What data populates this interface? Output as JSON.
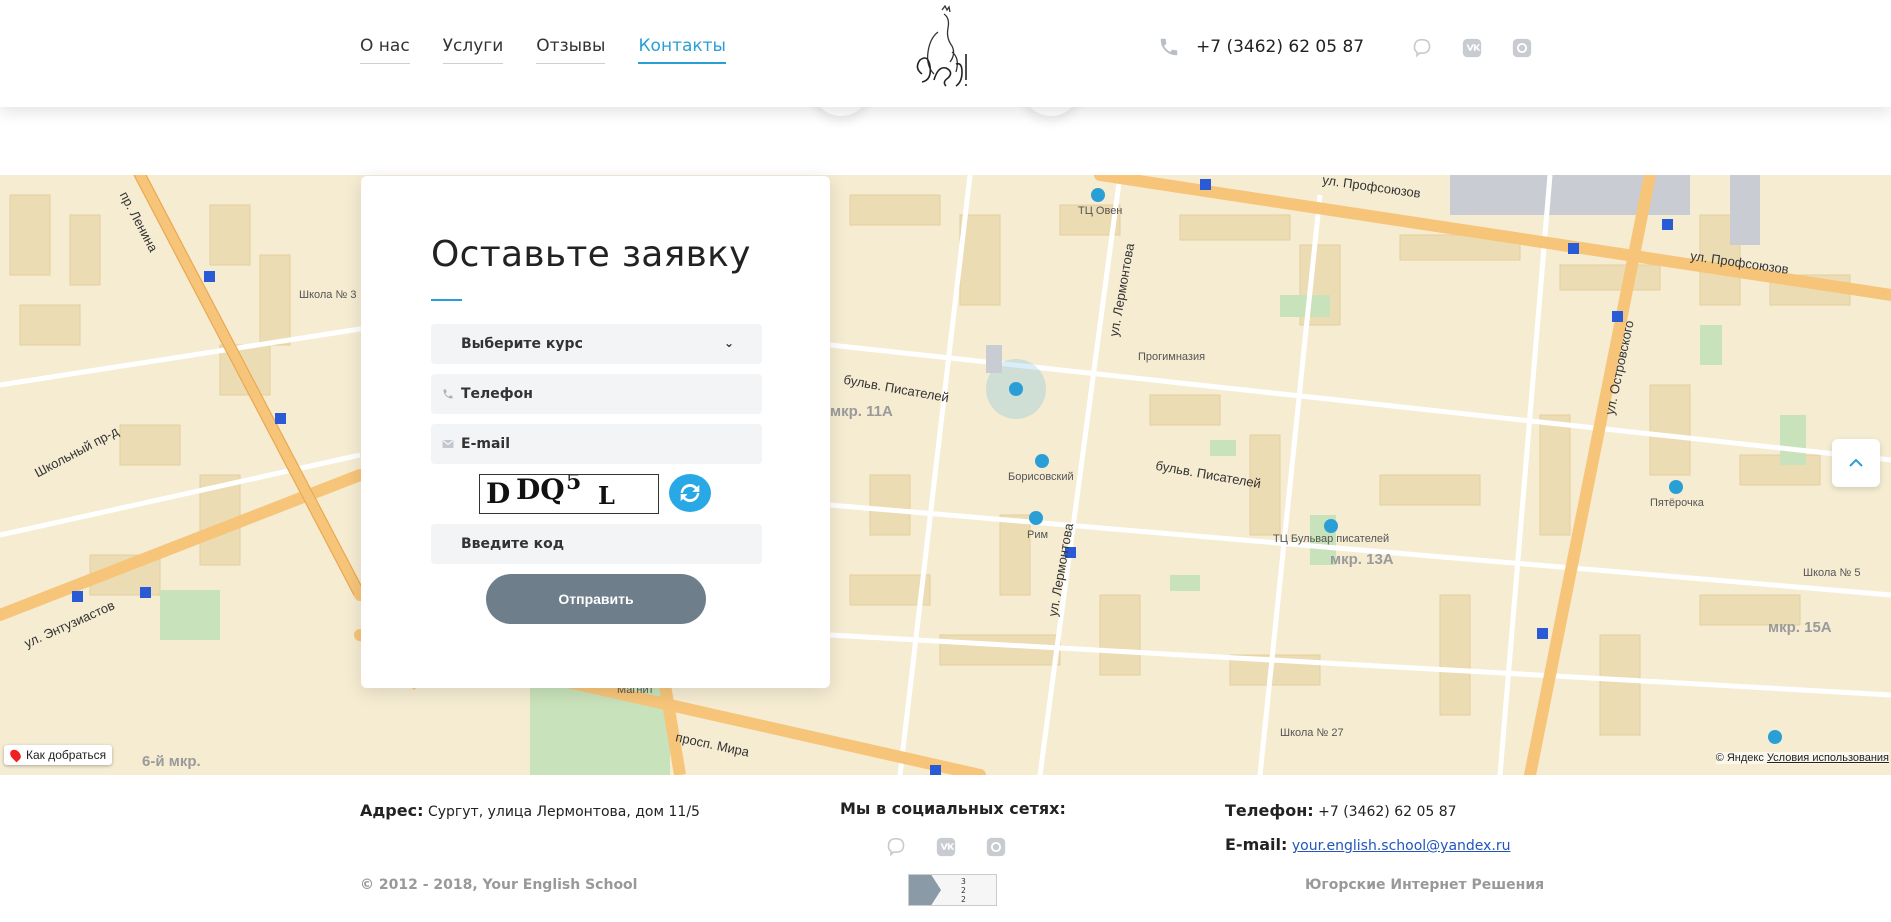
{
  "header": {
    "nav": [
      {
        "label": "О нас",
        "active": false
      },
      {
        "label": "Услуги",
        "active": false
      },
      {
        "label": "Отзывы",
        "active": false
      },
      {
        "label": "Контакты",
        "active": true
      }
    ],
    "phone": "+7 (3462) 62 05 87",
    "social_icons": [
      "viber-icon",
      "vk-icon",
      "instagram-icon"
    ]
  },
  "map": {
    "labels": {
      "lenina": "пр. Ленина",
      "profsoyuzov_1": "ул. Профсоюзов",
      "profsoyuzov_2": "ул. Профсоюзов",
      "pisateley_1": "бульв. Писателей",
      "pisateley_2": "бульв. Писателей",
      "lermontova_1": "ул. Лермонтова",
      "lermontova_2": "ул. Лермонтова",
      "ostrovskogo": "ул. Островского",
      "shkolny": "Школьный пр-д",
      "entuziastov": "ул. Энтузиастов",
      "mira": "просп. Мира",
      "mkr11a": "мкр. 11А",
      "mkr13a": "мкр. 13А",
      "mkr15a": "мкр. 15А",
      "mkr6": "6-й мкр.",
      "tc_oven": "ТЦ Овен",
      "progimnaziya": "Прогимназия",
      "borisovsky": "Борисовский",
      "rim": "Рим",
      "tc_bulvar": "ТЦ Бульвар писателей",
      "pyaterochka": "Пятёрочка",
      "school5": "Школа № 5",
      "school27": "Школа № 27",
      "school3": "Школа № 3",
      "magnit": "Магнит"
    },
    "route_button": "Как добраться",
    "copyright": "© Яндекс",
    "terms_link": "Условия использования"
  },
  "form": {
    "title": "Оставьте заявку",
    "course_select": "Выберите курс",
    "phone_placeholder": "Телефон",
    "email_placeholder": "E-mail",
    "captcha_text": "D DQ5 L",
    "code_placeholder": "Введите код",
    "submit_label": "Отправить"
  },
  "footer": {
    "address_label": "Адрес:",
    "address_value": "Сургут, улица Лермонтова, дом 11/5",
    "social_title": "Мы в социальных сетях:",
    "phone_label": "Телефон:",
    "phone_value": "+7 (3462) 62 05 87",
    "email_label": "E-mail:",
    "email_value": "your.english.school@yandex.ru",
    "copyright": "© 2012 - 2018, Your English School",
    "developer": "Югорские Интернет Решения",
    "counter_lines": [
      "3",
      "2",
      "2"
    ]
  },
  "colors": {
    "accent": "#2a9fd6",
    "map_bg": "#f5ecd2",
    "road_major": "#f7c57a",
    "submit_bg": "#6e7f8b"
  }
}
